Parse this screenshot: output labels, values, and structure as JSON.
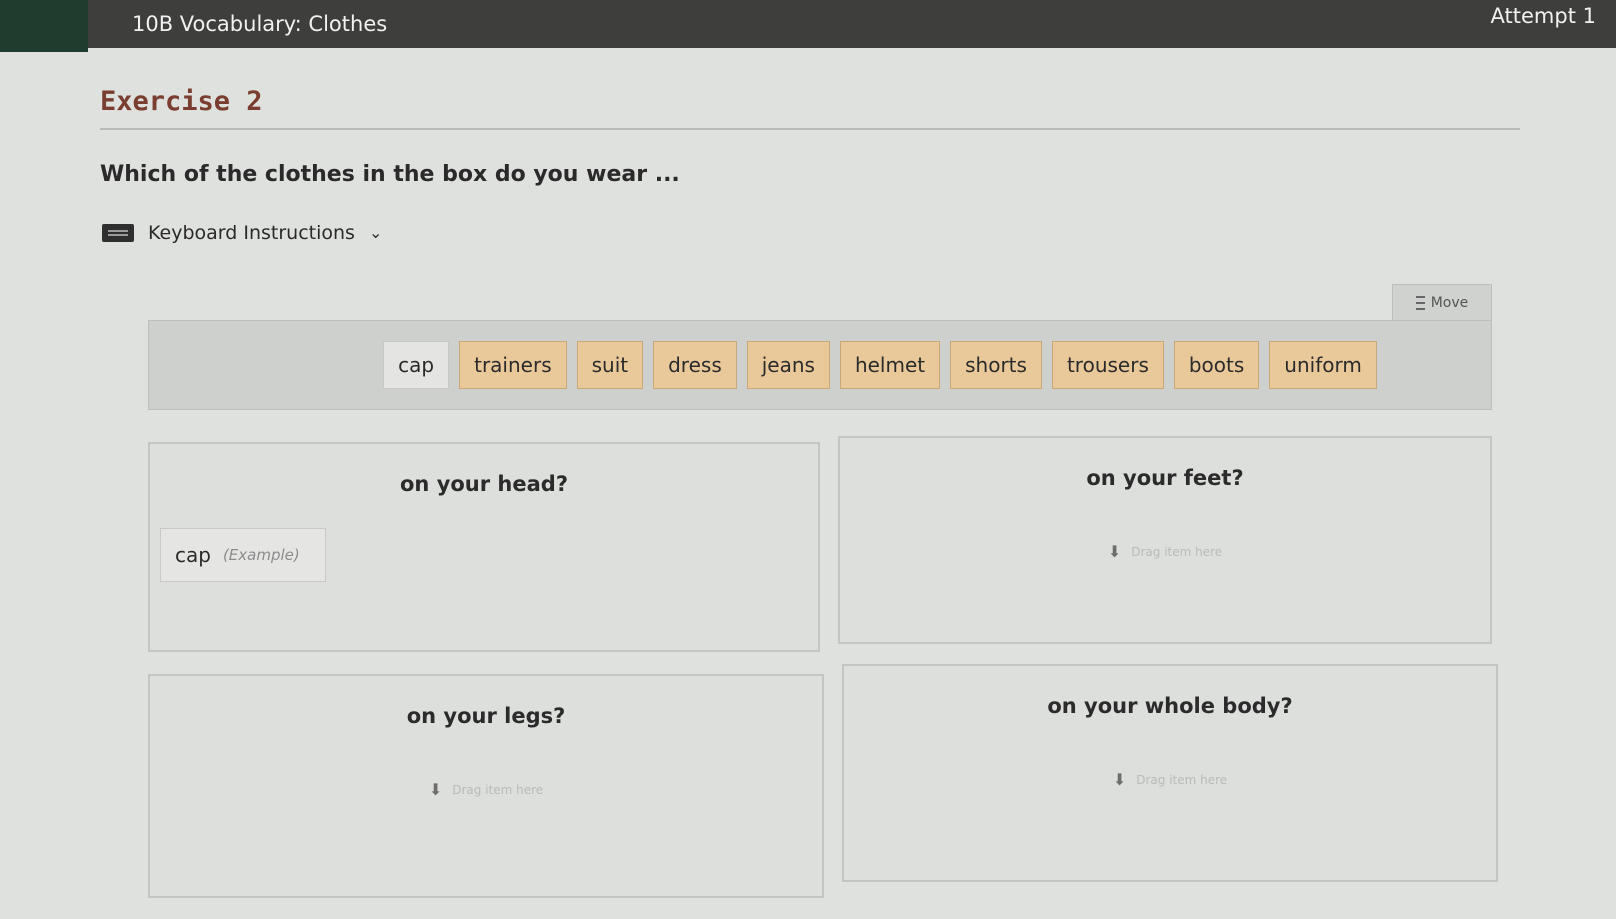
{
  "header": {
    "title": "10B Vocabulary: Clothes",
    "attempt": "Attempt 1"
  },
  "exercise": {
    "title": "Exercise 2",
    "question": "Which of the clothes in the box do you wear ...",
    "keyboard_instructions": "Keyboard Instructions"
  },
  "bank": {
    "move_label": "Move",
    "items": [
      {
        "label": "cap",
        "used": true
      },
      {
        "label": "trainers",
        "used": false
      },
      {
        "label": "suit",
        "used": false
      },
      {
        "label": "dress",
        "used": false
      },
      {
        "label": "jeans",
        "used": false
      },
      {
        "label": "helmet",
        "used": false
      },
      {
        "label": "shorts",
        "used": false
      },
      {
        "label": "trousers",
        "used": false
      },
      {
        "label": "boots",
        "used": false
      },
      {
        "label": "uniform",
        "used": false
      }
    ]
  },
  "zones": [
    {
      "label": "on your head?",
      "placed": "cap",
      "placed_note": "(Example)"
    },
    {
      "label": "on your feet?",
      "drop_hint": "Drag item here"
    },
    {
      "label": "on your legs?",
      "drop_hint": "Drag item here"
    },
    {
      "label": "on your whole body?",
      "drop_hint": "Drag item here"
    }
  ]
}
